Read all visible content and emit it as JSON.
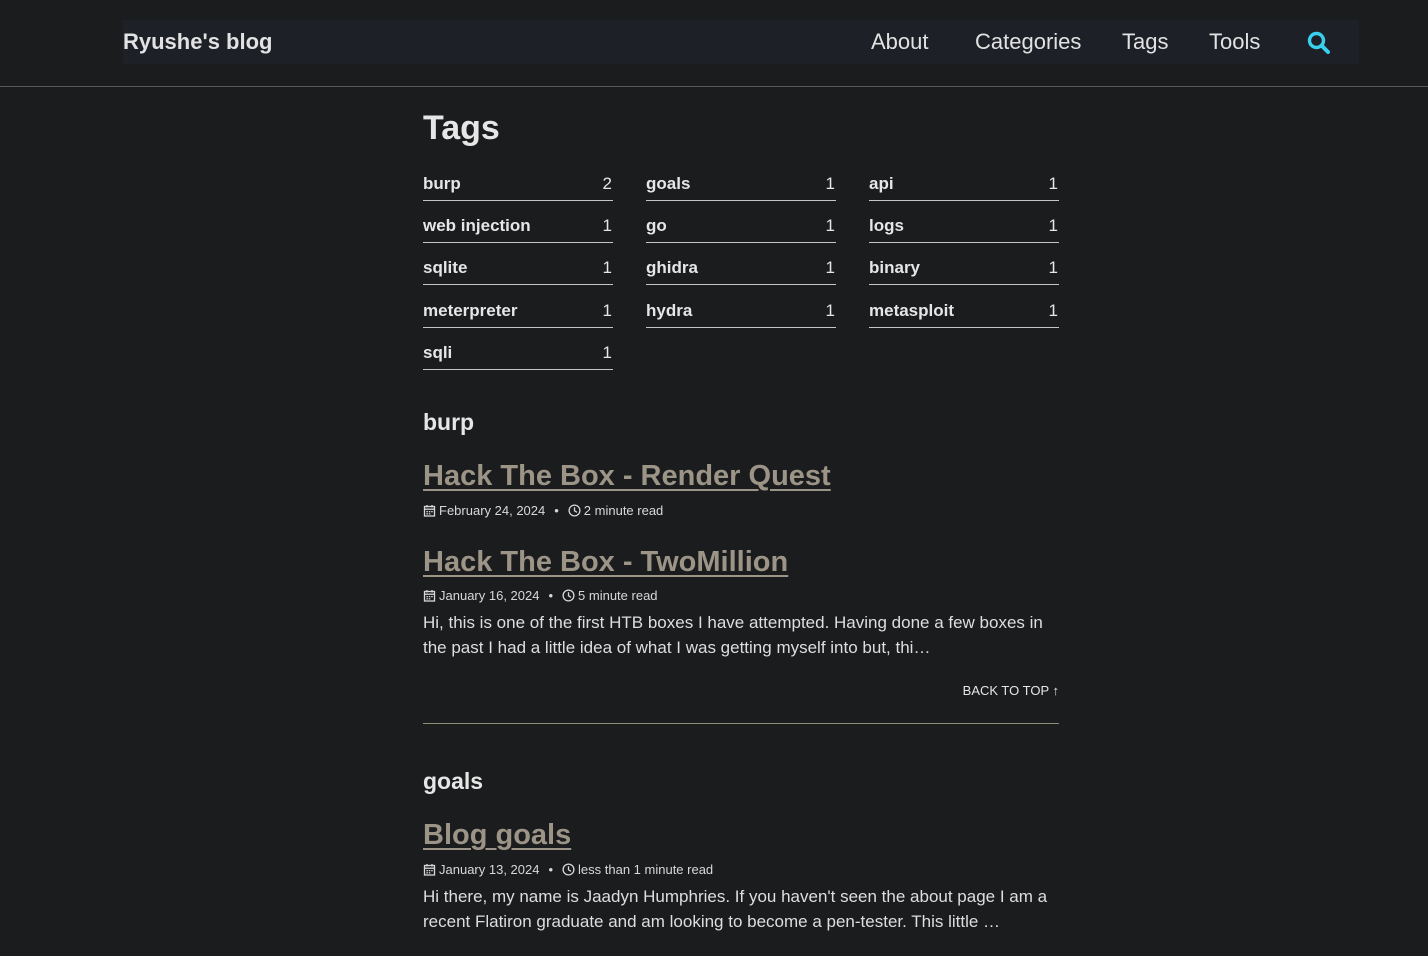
{
  "header": {
    "site_title": "Ryushe's blog",
    "nav": [
      "About",
      "Categories",
      "Tags",
      "Tools"
    ],
    "search_icon": "search-icon",
    "accent_color": "#38d0ee"
  },
  "page": {
    "title": "Tags",
    "tags": [
      {
        "name": "burp",
        "count": "2"
      },
      {
        "name": "goals",
        "count": "1"
      },
      {
        "name": "api",
        "count": "1"
      },
      {
        "name": "web injection",
        "count": "1"
      },
      {
        "name": "go",
        "count": "1"
      },
      {
        "name": "logs",
        "count": "1"
      },
      {
        "name": "sqlite",
        "count": "1"
      },
      {
        "name": "ghidra",
        "count": "1"
      },
      {
        "name": "binary",
        "count": "1"
      },
      {
        "name": "meterpreter",
        "count": "1"
      },
      {
        "name": "hydra",
        "count": "1"
      },
      {
        "name": "metasploit",
        "count": "1"
      },
      {
        "name": "sqli",
        "count": "1"
      }
    ]
  },
  "sections": [
    {
      "name": "burp",
      "posts": [
        {
          "title": "Hack The Box - Render Quest",
          "date": "February 24, 2024",
          "read_time": "2 minute read",
          "excerpt": ""
        },
        {
          "title": "Hack The Box - TwoMillion",
          "date": "January 16, 2024",
          "read_time": "5 minute read",
          "excerpt": "Hi, this is one of the first HTB boxes I have attempted. Having done a few boxes in the past I had a little idea of what I was getting myself into but, thi…"
        }
      ],
      "back_to_top": "Back to top ↑"
    },
    {
      "name": "goals",
      "posts": [
        {
          "title": "Blog goals",
          "date": "January 13, 2024",
          "read_time": "less than 1 minute read",
          "excerpt": "Hi there, my name is Jaadyn Humphries. If you haven't seen the about page I am a recent Flatiron graduate and am looking to become a pen-tester. This little …"
        }
      ]
    }
  ],
  "icons": {
    "date": "calendar-icon",
    "read_time": "clock-icon"
  }
}
